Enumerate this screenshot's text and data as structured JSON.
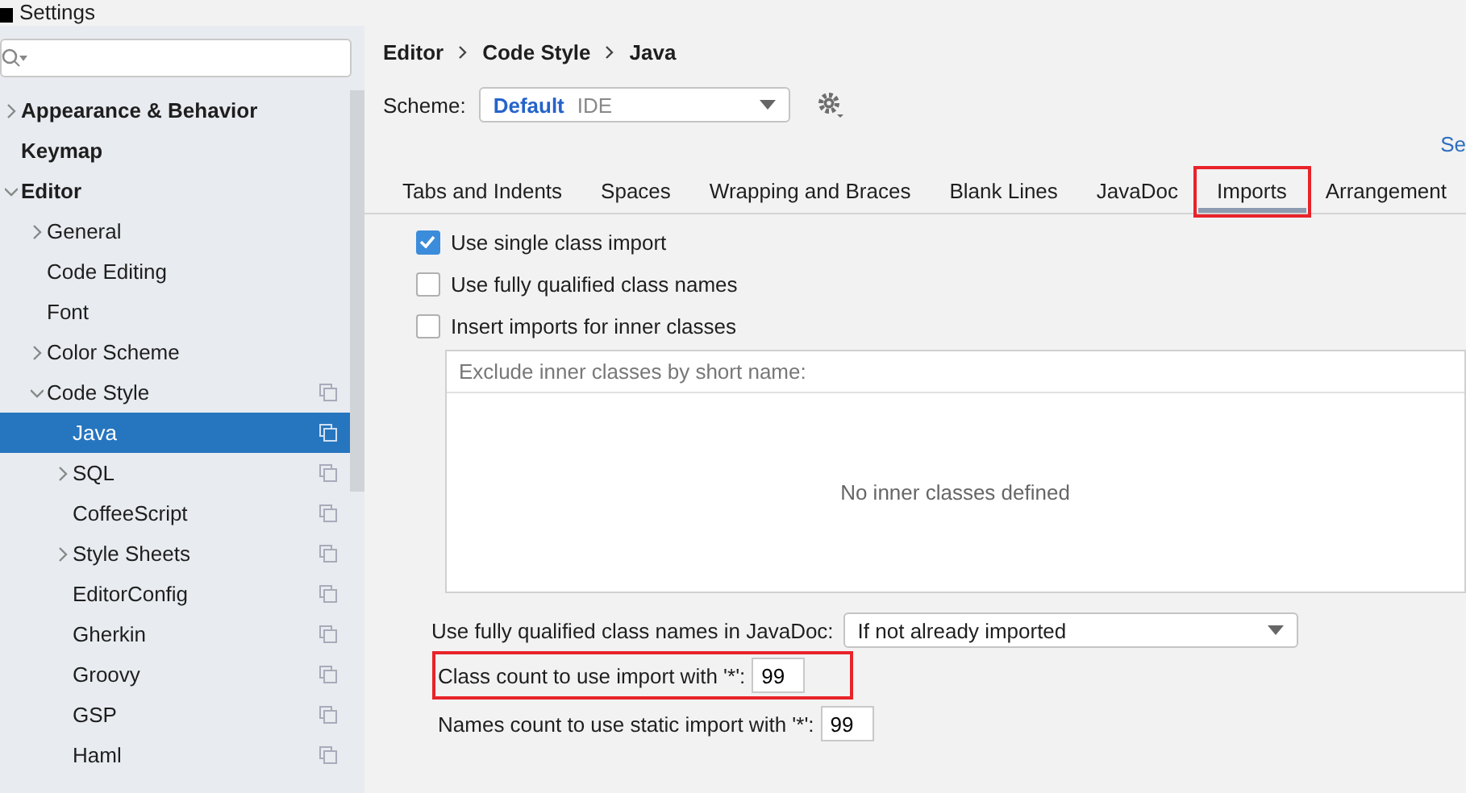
{
  "window": {
    "title": "Settings"
  },
  "sidebar": {
    "items": [
      {
        "label": "Appearance & Behavior",
        "bold": true,
        "expanded": false,
        "has_arrow": true,
        "scheme_icon": false,
        "selected": false
      },
      {
        "label": "Keymap",
        "bold": true,
        "has_arrow": false,
        "scheme_icon": false,
        "selected": false
      },
      {
        "label": "Editor",
        "bold": true,
        "expanded": true,
        "has_arrow": true,
        "scheme_icon": false,
        "selected": false,
        "children": [
          {
            "label": "General",
            "expanded": false,
            "has_arrow": true,
            "scheme_icon": false,
            "selected": false
          },
          {
            "label": "Code Editing",
            "has_arrow": false,
            "scheme_icon": false,
            "selected": false
          },
          {
            "label": "Font",
            "has_arrow": false,
            "scheme_icon": false,
            "selected": false
          },
          {
            "label": "Color Scheme",
            "expanded": false,
            "has_arrow": true,
            "scheme_icon": false,
            "selected": false
          },
          {
            "label": "Code Style",
            "expanded": true,
            "has_arrow": true,
            "scheme_icon": true,
            "selected": false,
            "children": [
              {
                "label": "Java",
                "has_arrow": false,
                "scheme_icon": true,
                "selected": true
              },
              {
                "label": "SQL",
                "expanded": false,
                "has_arrow": true,
                "scheme_icon": true,
                "selected": false
              },
              {
                "label": "CoffeeScript",
                "has_arrow": false,
                "scheme_icon": true,
                "selected": false
              },
              {
                "label": "Style Sheets",
                "expanded": false,
                "has_arrow": true,
                "scheme_icon": true,
                "selected": false
              },
              {
                "label": "EditorConfig",
                "has_arrow": false,
                "scheme_icon": true,
                "selected": false
              },
              {
                "label": "Gherkin",
                "has_arrow": false,
                "scheme_icon": true,
                "selected": false
              },
              {
                "label": "Groovy",
                "has_arrow": false,
                "scheme_icon": true,
                "selected": false
              },
              {
                "label": "GSP",
                "has_arrow": false,
                "scheme_icon": true,
                "selected": false
              },
              {
                "label": "Haml",
                "has_arrow": false,
                "scheme_icon": true,
                "selected": false
              }
            ]
          }
        ]
      }
    ]
  },
  "breadcrumb": [
    "Editor",
    "Code Style",
    "Java"
  ],
  "scheme": {
    "label": "Scheme:",
    "name": "Default",
    "tag": "IDE"
  },
  "link": "Se",
  "tabs": [
    {
      "label": "Tabs and Indents",
      "selected": false,
      "highlighted": false
    },
    {
      "label": "Spaces",
      "selected": false,
      "highlighted": false
    },
    {
      "label": "Wrapping and Braces",
      "selected": false,
      "highlighted": false
    },
    {
      "label": "Blank Lines",
      "selected": false,
      "highlighted": false
    },
    {
      "label": "JavaDoc",
      "selected": false,
      "highlighted": false
    },
    {
      "label": "Imports",
      "selected": true,
      "highlighted": true
    },
    {
      "label": "Arrangement",
      "selected": false,
      "highlighted": false
    }
  ],
  "options": [
    {
      "label": "Use single class import",
      "checked": true
    },
    {
      "label": "Use fully qualified class names",
      "checked": false
    },
    {
      "label": "Insert imports for inner classes",
      "checked": false
    }
  ],
  "exclude_list": {
    "header": "Exclude inner classes by short name:",
    "empty_text": "No inner classes defined"
  },
  "javadoc": {
    "label": "Use fully qualified class names in JavaDoc:",
    "value": "If not already imported"
  },
  "counts": [
    {
      "label": "Class count to use import with '*':",
      "value": "99",
      "highlighted": true
    },
    {
      "label": "Names count to use static import with '*':",
      "value": "99",
      "highlighted": false
    }
  ]
}
